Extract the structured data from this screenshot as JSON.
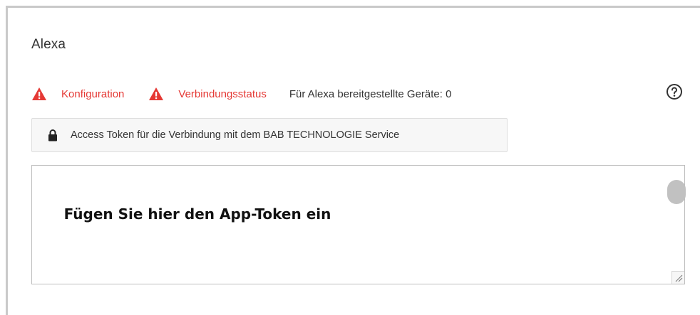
{
  "panel": {
    "title": "Alexa"
  },
  "status": {
    "configuration_label": "Konfiguration",
    "connection_label": "Verbindungsstatus",
    "devices_text": "Für Alexa bereitgestellte Geräte: 0",
    "warning_icon": "warning-triangle-icon",
    "warning_color": "#e53935"
  },
  "help": {
    "icon": "help-circle-icon"
  },
  "token_button": {
    "icon": "lock-icon",
    "label": "Access Token für die Verbindung mit dem BAB TECHNOLOGIE Service"
  },
  "token_input": {
    "value": "",
    "placeholder": "Fügen Sie hier den App-Token ein"
  }
}
